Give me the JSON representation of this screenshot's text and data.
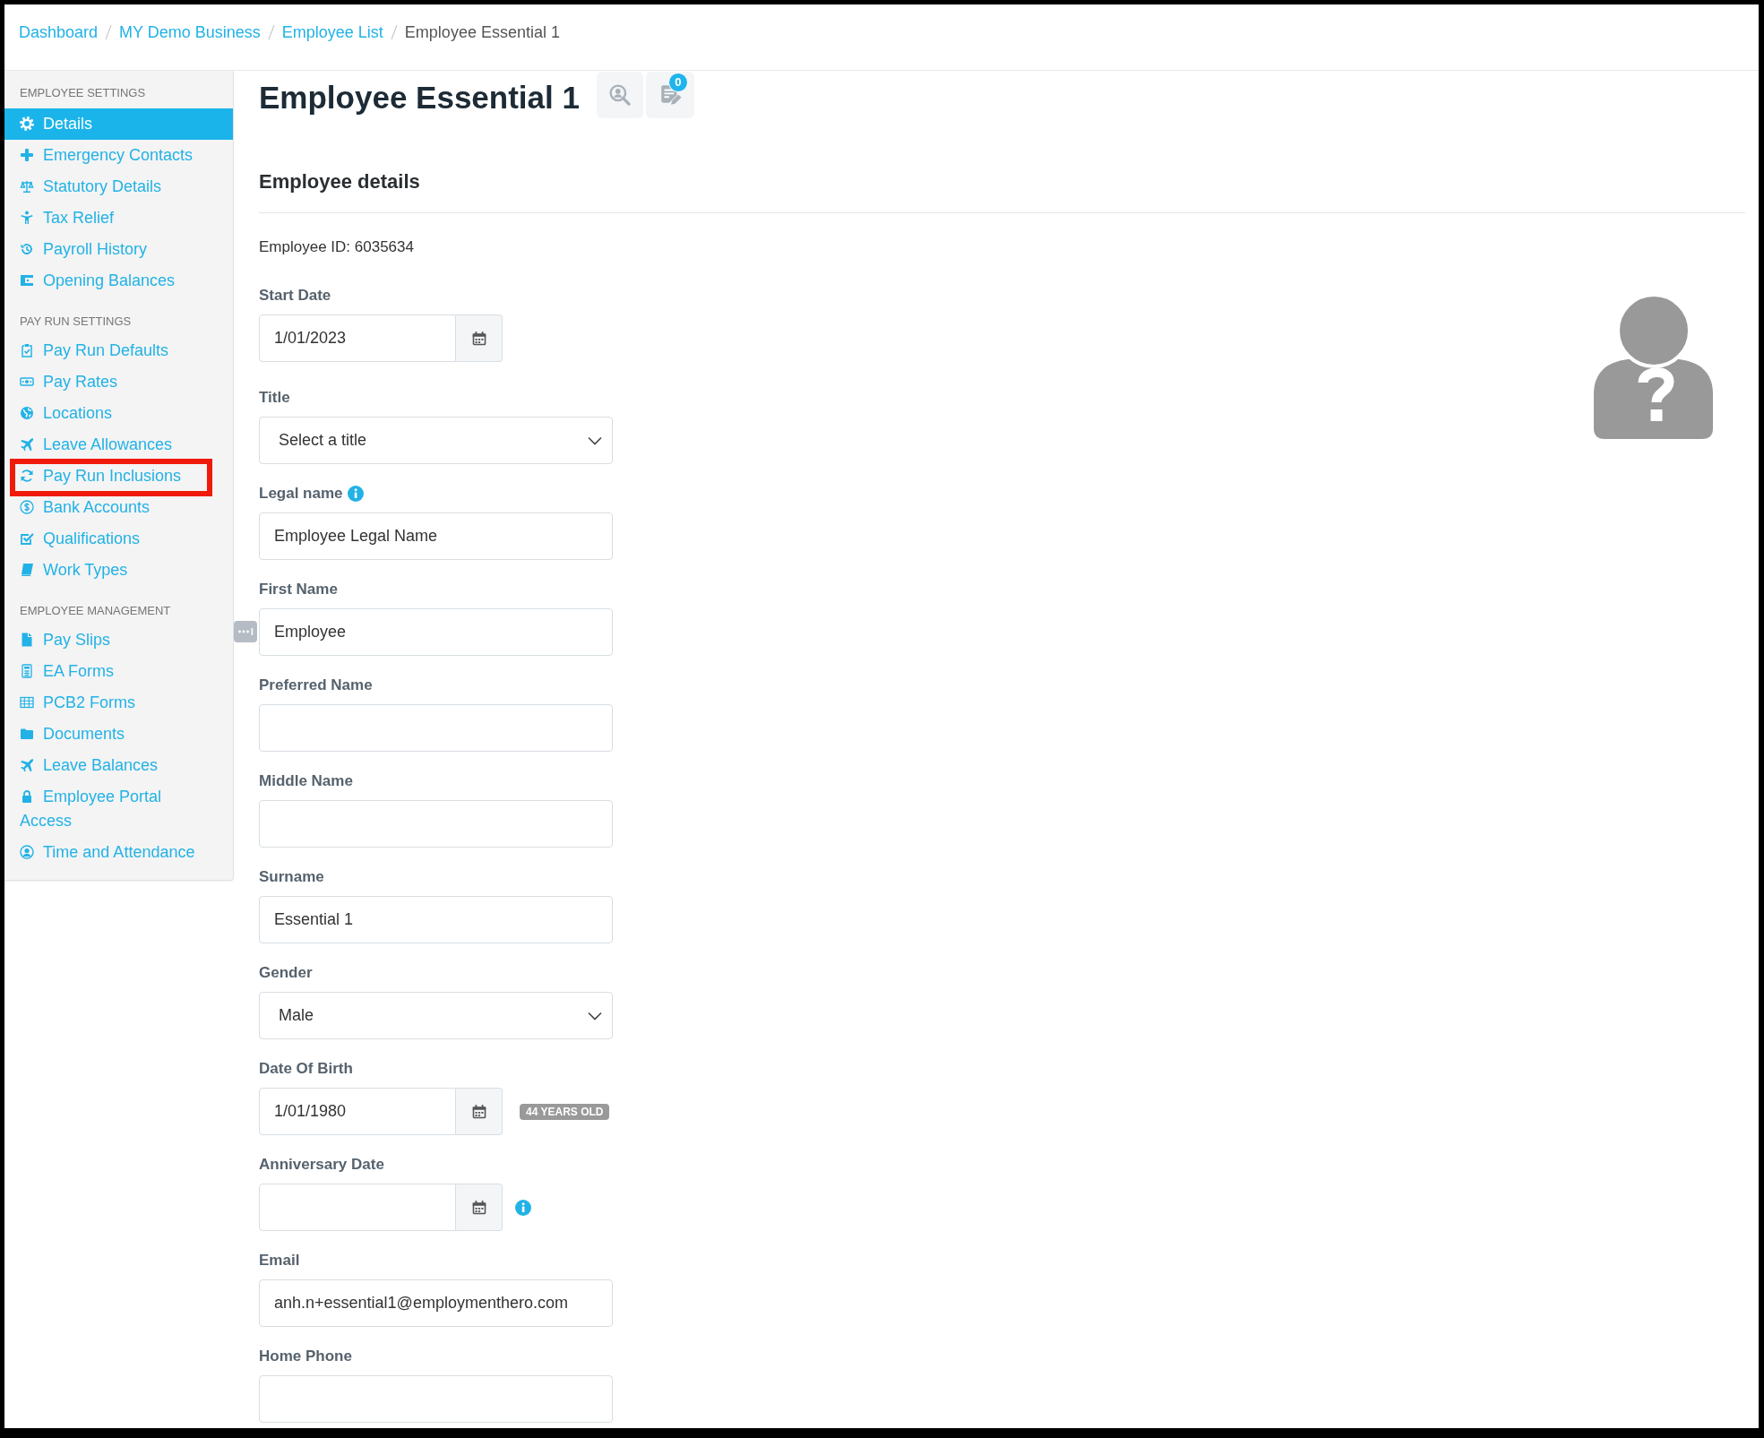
{
  "breadcrumb": [
    {
      "label": "Dashboard",
      "link": true
    },
    {
      "label": "MY Demo Business",
      "link": true
    },
    {
      "label": "Employee List",
      "link": true
    },
    {
      "label": "Employee Essential 1",
      "link": false
    }
  ],
  "sidebar": {
    "sections": [
      {
        "heading": "EMPLOYEE SETTINGS",
        "items": [
          {
            "label": "Details",
            "selected": true,
            "highlighted": false
          },
          {
            "label": "Emergency Contacts",
            "selected": false,
            "highlighted": false
          },
          {
            "label": "Statutory Details",
            "selected": false,
            "highlighted": false
          },
          {
            "label": "Tax Relief",
            "selected": false,
            "highlighted": false
          },
          {
            "label": "Payroll History",
            "selected": false,
            "highlighted": false
          },
          {
            "label": "Opening Balances",
            "selected": false,
            "highlighted": false
          }
        ]
      },
      {
        "heading": "PAY RUN SETTINGS",
        "items": [
          {
            "label": "Pay Run Defaults",
            "selected": false,
            "highlighted": false
          },
          {
            "label": "Pay Rates",
            "selected": false,
            "highlighted": false
          },
          {
            "label": "Locations",
            "selected": false,
            "highlighted": false
          },
          {
            "label": "Leave Allowances",
            "selected": false,
            "highlighted": false
          },
          {
            "label": "Pay Run Inclusions",
            "selected": false,
            "highlighted": true
          },
          {
            "label": "Bank Accounts",
            "selected": false,
            "highlighted": false
          },
          {
            "label": "Qualifications",
            "selected": false,
            "highlighted": false
          },
          {
            "label": "Work Types",
            "selected": false,
            "highlighted": false
          }
        ]
      },
      {
        "heading": "EMPLOYEE MANAGEMENT",
        "items": [
          {
            "label": "Pay Slips",
            "selected": false,
            "highlighted": false
          },
          {
            "label": "EA Forms",
            "selected": false,
            "highlighted": false
          },
          {
            "label": "PCB2 Forms",
            "selected": false,
            "highlighted": false
          },
          {
            "label": "Documents",
            "selected": false,
            "highlighted": false
          },
          {
            "label": "Leave Balances",
            "selected": false,
            "highlighted": false
          },
          {
            "label": "Employee Portal Access",
            "selected": false,
            "highlighted": false
          },
          {
            "label": "Time and Attendance",
            "selected": false,
            "highlighted": false
          }
        ]
      }
    ]
  },
  "header": {
    "title": "Employee Essential 1",
    "notes_count": "0"
  },
  "form": {
    "heading": "Employee details",
    "employee_id": "Employee ID: 6035634",
    "fields": [
      {
        "kind": "date",
        "label": "Start Date",
        "value": "1/01/2023"
      },
      {
        "kind": "select",
        "label": "Title",
        "value": "Select a title"
      },
      {
        "kind": "text",
        "label": "Legal name",
        "value": "Employee Legal Name",
        "label_info": true
      },
      {
        "kind": "text",
        "label": "First Name",
        "value": "Employee"
      },
      {
        "kind": "text",
        "label": "Preferred Name"
      },
      {
        "kind": "text",
        "label": "Middle Name"
      },
      {
        "kind": "text",
        "label": "Surname",
        "value": "Essential 1"
      },
      {
        "kind": "select",
        "label": "Gender",
        "value": "Male"
      },
      {
        "kind": "date",
        "label": "Date Of Birth",
        "value": "1/01/1980",
        "badge": "44 YEARS OLD"
      },
      {
        "kind": "date",
        "label": "Anniversary Date",
        "field_info": true
      },
      {
        "kind": "text",
        "label": "Email",
        "value": "anh.n+essential1@employmenthero.com"
      },
      {
        "kind": "text",
        "label": "Home Phone"
      }
    ]
  }
}
